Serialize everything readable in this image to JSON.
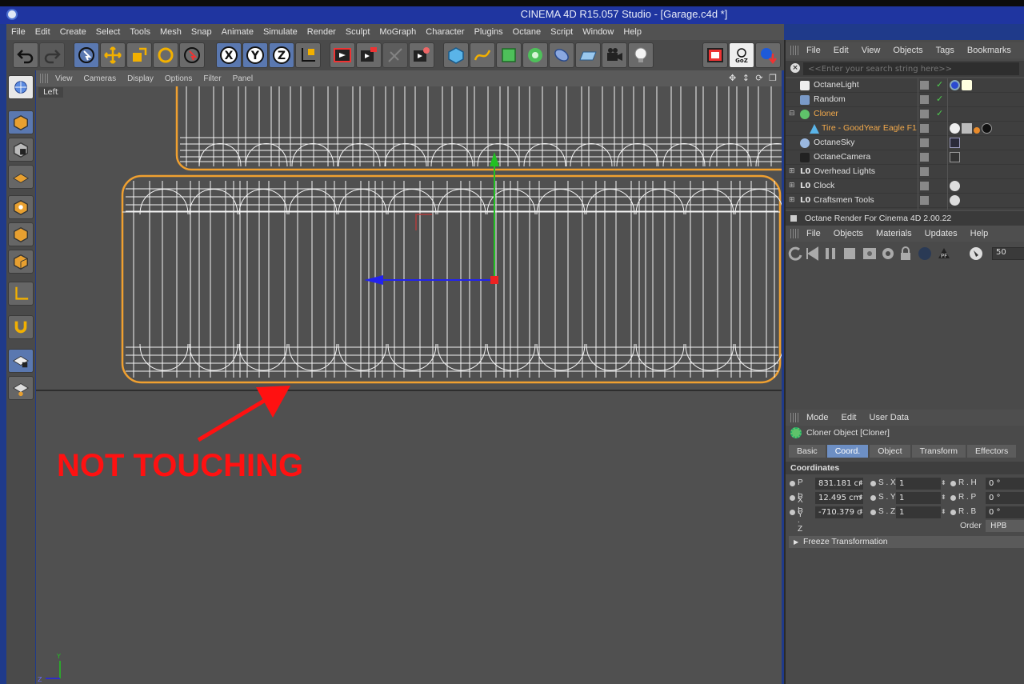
{
  "window": {
    "title": "CINEMA 4D R15.057 Studio - [Garage.c4d *]"
  },
  "menubar": [
    "File",
    "Edit",
    "Create",
    "Select",
    "Tools",
    "Mesh",
    "Snap",
    "Animate",
    "Simulate",
    "Render",
    "Sculpt",
    "MoGraph",
    "Character",
    "Plugins",
    "Octane",
    "Script",
    "Window",
    "Help"
  ],
  "toolbar_icons": [
    "undo-icon",
    "redo-icon",
    "live-selection-icon",
    "move-icon",
    "scale-icon",
    "rotate-icon",
    "last-tool-icon",
    "x-axis-icon",
    "y-axis-icon",
    "z-axis-icon",
    "coordinate-system-icon",
    "render-view-icon",
    "render-picture-viewer-icon",
    "edit-render-settings-icon",
    "render-to-pv-icon",
    "cube-primitive-icon",
    "spline-pen-icon",
    "subdivision-surface-icon",
    "cloner-array-icon",
    "deformer-icon",
    "floor-environment-icon",
    "camera-icon",
    "light-icon",
    "octane-render-icon",
    "goz-icon",
    "export-icon"
  ],
  "goz_label": "GoZ",
  "axis_labels": {
    "x": "X",
    "y": "Y",
    "z": "Z"
  },
  "viewport": {
    "menu": [
      "View",
      "Cameras",
      "Display",
      "Options",
      "Filter",
      "Panel"
    ],
    "controls": "✥ ↕ ⟳ ❐",
    "view_name": "Left",
    "annotation": "NOT TOUCHING",
    "annotation_color": "#ff1111",
    "axis_y_label": "Y",
    "axis_z_label": "Z"
  },
  "object_manager": {
    "menu": [
      "File",
      "Edit",
      "View",
      "Objects",
      "Tags",
      "Bookmarks"
    ],
    "search_placeholder": "<<Enter your search string here>>",
    "objects": [
      {
        "name": "OctaneLight",
        "highlight": false
      },
      {
        "name": "Random",
        "highlight": false
      },
      {
        "name": "Cloner",
        "highlight": true
      },
      {
        "name": "Tire - GoodYear Eagle F1",
        "highlight": true
      },
      {
        "name": "OctaneSky",
        "highlight": false
      },
      {
        "name": "OctaneCamera",
        "highlight": false
      },
      {
        "name": "Overhead Lights",
        "highlight": false
      },
      {
        "name": "Clock",
        "highlight": false
      },
      {
        "name": "Craftsmen Tools",
        "highlight": false
      }
    ]
  },
  "octane_panel": {
    "title": "Octane Render For Cinema 4D 2.00.22",
    "menu": [
      "File",
      "Objects",
      "Materials",
      "Updates",
      "Help"
    ],
    "field_value": "50"
  },
  "attribute_manager": {
    "menu": [
      "Mode",
      "Edit",
      "User Data"
    ],
    "object_title": "Cloner Object [Cloner]",
    "tabs": [
      "Basic",
      "Coord.",
      "Object",
      "Transform",
      "Effectors"
    ],
    "active_tab": "Coord.",
    "section": "Coordinates",
    "rows": [
      {
        "p_label": "P . X",
        "p_value": "831.181 cı",
        "s_label": "S . X",
        "s_value": "1",
        "r_label": "R . H",
        "r_value": "0 °"
      },
      {
        "p_label": "P . Y",
        "p_value": "12.495 cm",
        "s_label": "S . Y",
        "s_value": "1",
        "r_label": "R . P",
        "r_value": "0 °"
      },
      {
        "p_label": "P . Z",
        "p_value": "-710.379 c",
        "s_label": "S . Z",
        "s_value": "1",
        "r_label": "R . B",
        "r_value": "0 °"
      }
    ],
    "order_label": "Order",
    "order_value": "HPB",
    "freeze_label": "Freeze Transformation"
  },
  "colors": {
    "selection_orange": "#f0a030",
    "active_blue": "#5a78b0",
    "axis_green": "#22c022",
    "axis_blue": "#2222ee",
    "axis_red": "#ee2222"
  }
}
